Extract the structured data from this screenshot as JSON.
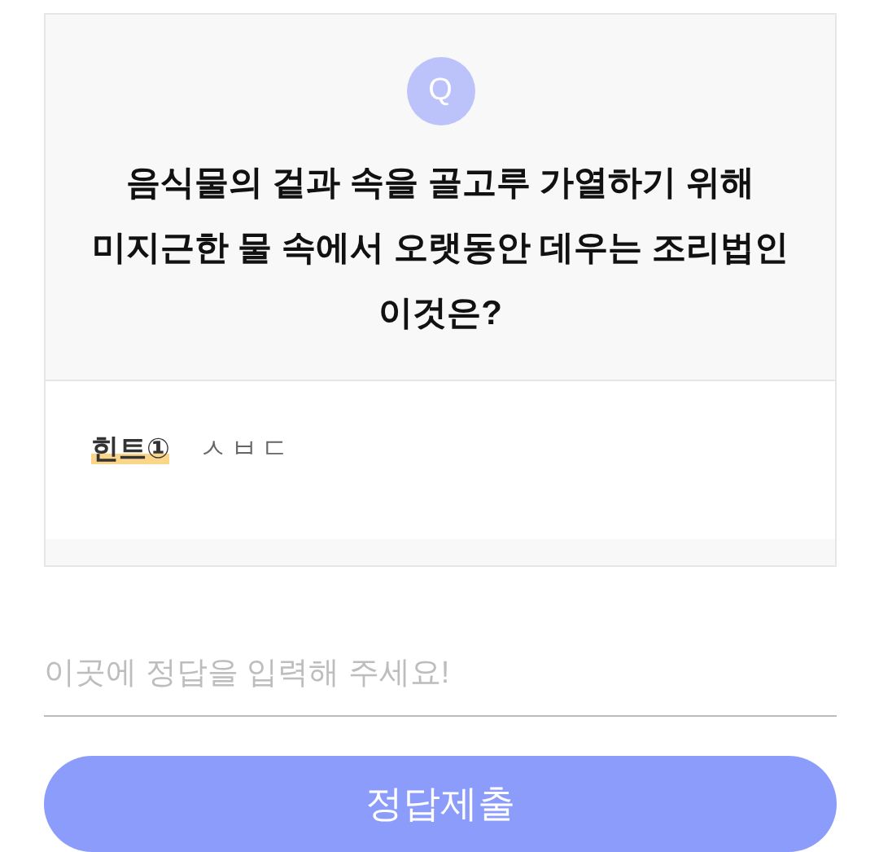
{
  "question": {
    "badge": "Q",
    "text": "음식물의 겉과 속을 골고루 가열하기 위해 미지근한 물 속에서 오랫동안 데우는 조리법인 이것은?"
  },
  "hints": [
    {
      "label": "힌트①",
      "text": "ㅅㅂㄷ"
    }
  ],
  "answer": {
    "placeholder": "이곳에 정답을 입력해 주세요!"
  },
  "submit": {
    "label": "정답제출"
  }
}
